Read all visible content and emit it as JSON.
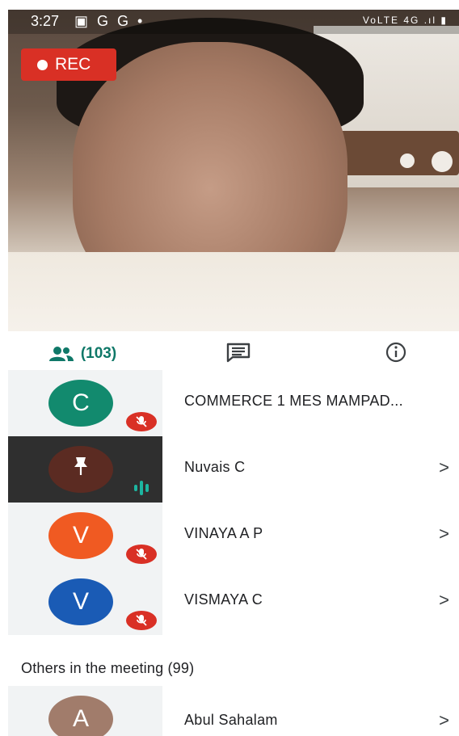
{
  "status_bar": {
    "time": "3:27",
    "icons": "▣ G G •",
    "right": "VoLTE 4G .ıl ▮"
  },
  "recording": {
    "label": "REC"
  },
  "tabs": {
    "people_count": "(103)",
    "people_icon": "people-icon",
    "chat_icon": "chat-icon",
    "info_icon": "info-icon"
  },
  "colors": {
    "accent": "#0f7868",
    "mute": "#d93025",
    "speaking": "#1db5a0"
  },
  "participants": [
    {
      "initial": "C",
      "name": "COMMERCE 1 MES MAMPAD...",
      "avatar_color": "#128a6e",
      "state": "muted",
      "chevron": ""
    },
    {
      "initial": "",
      "name": "Nuvais C",
      "avatar_color": "#5b2b22",
      "state": "speaking",
      "chevron": ">"
    },
    {
      "initial": "V",
      "name": "VINAYA A P",
      "avatar_color": "#f05a22",
      "state": "muted",
      "chevron": ">"
    },
    {
      "initial": "V",
      "name": "VISMAYA C",
      "avatar_color": "#1a5bb5",
      "state": "muted",
      "chevron": ">"
    }
  ],
  "others_section": {
    "title": "Others in the meeting (99)"
  },
  "others": [
    {
      "initial": "A",
      "name": "Abul Sahalam",
      "avatar_color": "#a17c6b",
      "chevron": ">"
    }
  ]
}
